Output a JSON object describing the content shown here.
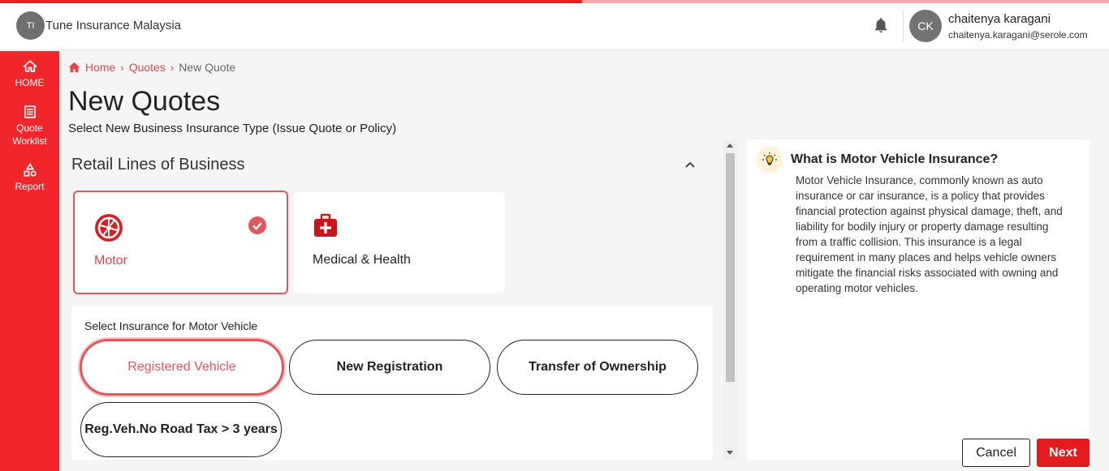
{
  "progress": {
    "fraction": 0.525,
    "color": "#f21b1f"
  },
  "header": {
    "org_initials": "TI",
    "org_name": "Tune Insurance Malaysia",
    "user_initials": "CK",
    "user_name": "chaitenya karagani",
    "user_email": "chaitenya.karagani@serole.com"
  },
  "sidebar": {
    "items": [
      {
        "label": "HOME",
        "icon": "home-icon"
      },
      {
        "label": "Quote Worklist",
        "icon": "list-icon"
      },
      {
        "label": "Report",
        "icon": "report-icon"
      }
    ]
  },
  "breadcrumb": {
    "home": "Home",
    "quotes": "Quotes",
    "current": "New Quote"
  },
  "page": {
    "title": "New Quotes",
    "subtitle": "Select New Business Insurance Type (Issue Quote or Policy)"
  },
  "section": {
    "title": "Retail Lines of Business"
  },
  "business_lines": [
    {
      "label": "Motor",
      "icon": "wheel-icon",
      "selected": true
    },
    {
      "label": "Medical & Health",
      "icon": "medical-kit-icon",
      "selected": false
    }
  ],
  "motor_panel": {
    "label": "Select Insurance for Motor Vehicle",
    "options": [
      "Registered Vehicle",
      "New Registration",
      "Transfer of Ownership",
      "Reg.Veh.No Road Tax > 3 years"
    ],
    "selected": "Registered Vehicle"
  },
  "info": {
    "title": "What is Motor Vehicle Insurance?",
    "body": "Motor Vehicle Insurance, commonly known as auto insurance or car insurance, is a policy that provides financial protection against physical damage, theft, and liability for bodily injury or property damage resulting from a traffic collision. This insurance is a legal requirement in many places and helps vehicle owners mitigate the financial risks associated with owning and operating motor vehicles."
  },
  "actions": {
    "cancel": "Cancel",
    "next": "Next"
  },
  "colors": {
    "accent": "#f1262b",
    "brand_red": "#e0474c",
    "next_button": "#e41a1f"
  }
}
